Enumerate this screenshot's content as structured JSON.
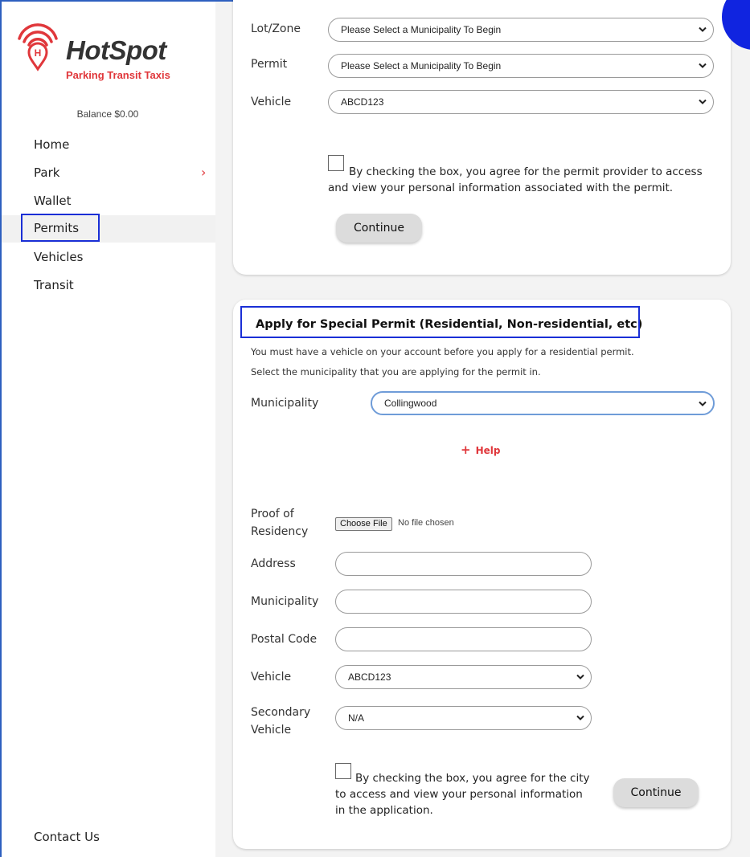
{
  "brand": {
    "name": "HotSpot",
    "tagline": "Parking Transit Taxis",
    "accent_color": "#e0373b"
  },
  "sidebar": {
    "balance": "Balance $0.00",
    "items": [
      {
        "label": "Home"
      },
      {
        "label": "Park"
      },
      {
        "label": "Wallet"
      },
      {
        "label": "Permits"
      },
      {
        "label": "Vehicles"
      },
      {
        "label": "Transit"
      }
    ],
    "active_item": "Permits",
    "contact": "Contact Us"
  },
  "permit_form": {
    "lot_zone_label": "Lot/Zone",
    "lot_zone_value": "Please Select a Municipality To Begin",
    "permit_label": "Permit",
    "permit_value": "Please Select a Municipality To Begin",
    "vehicle_label": "Vehicle",
    "vehicle_value": "ABCD123",
    "agree_text": "By checking the box, you agree for the permit provider to access and view your personal information associated with the permit.",
    "continue_label": "Continue"
  },
  "special_permit": {
    "heading": "Apply for Special Permit (Residential, Non-residential, etc)",
    "note1": "You must have a vehicle on your account before you apply for a residential permit.",
    "note2": "Select the municipality that you are applying for the permit in.",
    "municipality_label": "Municipality",
    "municipality_value": "Collingwood",
    "help_label": "Help",
    "proof_label": "Proof of Residency",
    "choose_file_label": "Choose File",
    "file_status": "No file chosen",
    "address_label": "Address",
    "address_value": "",
    "municipality_field_label": "Municipality",
    "municipality_field_value": "",
    "postal_code_label": "Postal Code",
    "postal_code_value": "",
    "vehicle_label": "Vehicle",
    "vehicle_value": "ABCD123",
    "secondary_vehicle_label": "Secondary Vehicle",
    "secondary_vehicle_value": "N/A",
    "agree_text": "By checking the box, you agree for the city to access and view your personal information in the application.",
    "continue_label": "Continue"
  }
}
